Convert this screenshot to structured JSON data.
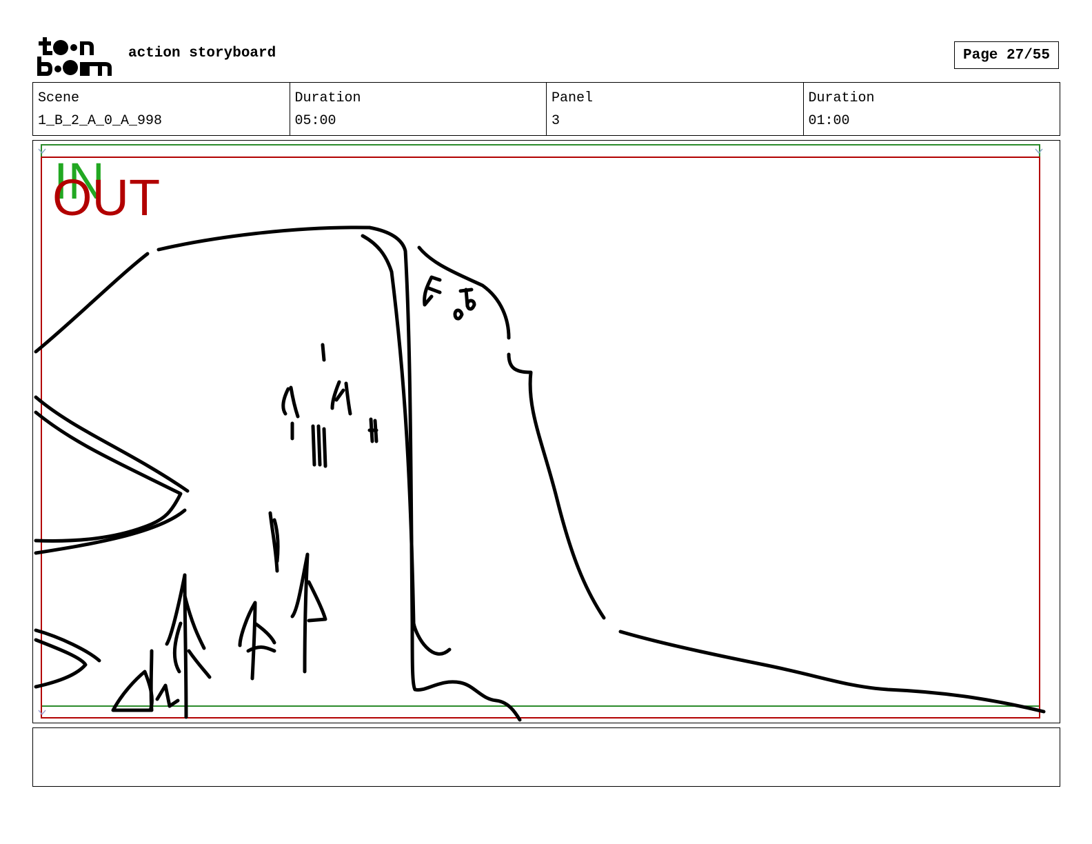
{
  "header": {
    "logo_text": "toon boom",
    "title": "action storyboard",
    "page_label": "Page 27/55"
  },
  "info": {
    "scene_label": "Scene",
    "scene_value": "1_B_2_A_0_A_998",
    "scene_duration_label": "Duration",
    "scene_duration_value": "05:00",
    "panel_label": "Panel",
    "panel_value": "3",
    "panel_duration_label": "Duration",
    "panel_duration_value": "01:00"
  },
  "panel": {
    "in_marker": "IN",
    "out_marker": "OUT",
    "colors": {
      "in_frame": "#2a8a2a",
      "out_frame": "#b20000",
      "in_text": "#22a822",
      "out_text": "#b20000"
    }
  },
  "notes": {
    "text": ""
  }
}
